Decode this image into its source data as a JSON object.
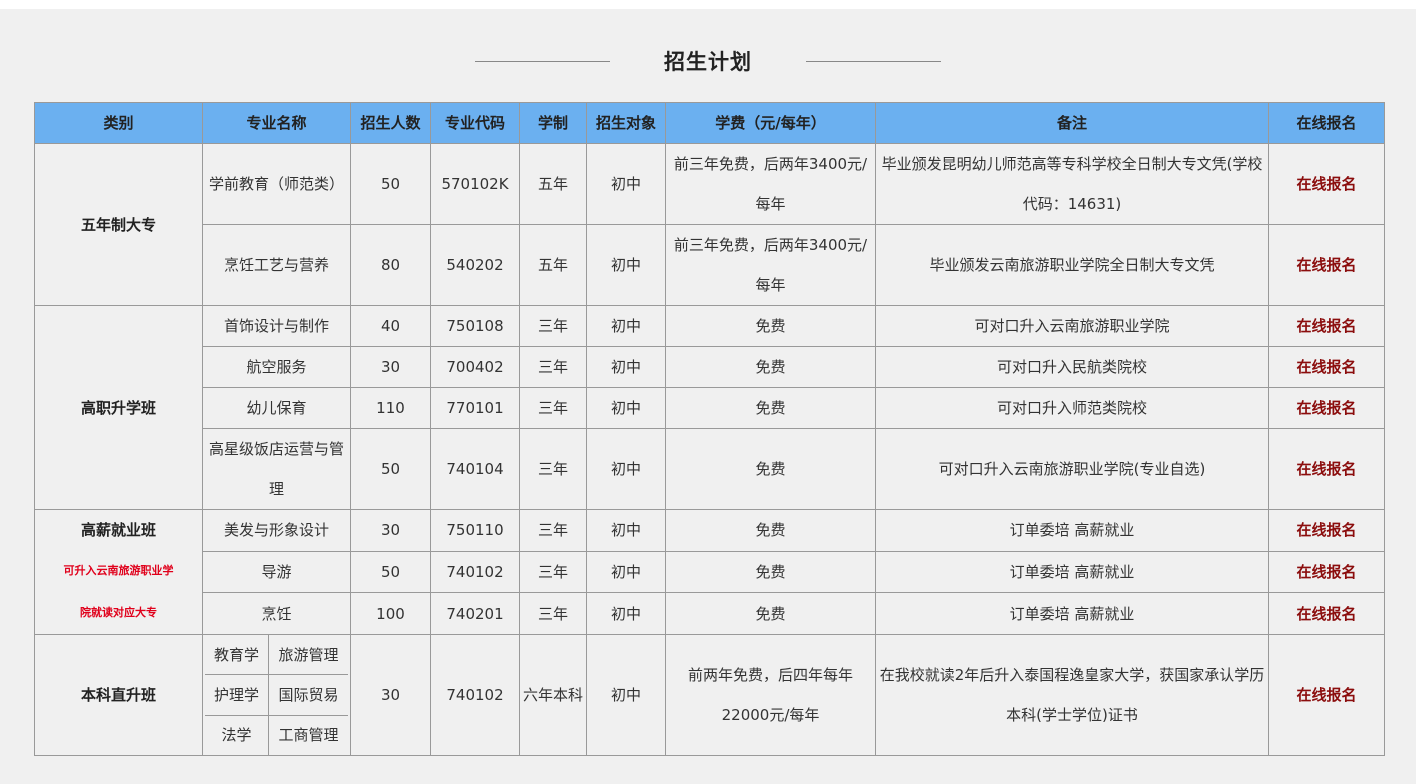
{
  "title": "招生计划",
  "headers": [
    "类别",
    "专业名称",
    "招生人数",
    "专业代码",
    "学制",
    "招生对象",
    "学费（元/每年）",
    "备注",
    "在线报名"
  ],
  "signup_label": "在线报名",
  "groups": {
    "g1": {
      "name": "五年制大专",
      "rows": [
        {
          "major": "学前教育（师范类）",
          "count": "50",
          "code": "570102K",
          "years": "五年",
          "target": "初中",
          "fee": "前三年免费，后两年3400元/每年",
          "note": "毕业颁发昆明幼儿师范高等专科学校全日制大专文凭(学校代码：14631)"
        },
        {
          "major": "烹饪工艺与营养",
          "count": "80",
          "code": "540202",
          "years": "五年",
          "target": "初中",
          "fee": "前三年免费，后两年3400元/每年",
          "note": "毕业颁发云南旅游职业学院全日制大专文凭"
        }
      ]
    },
    "g2": {
      "name": "高职升学班",
      "rows": [
        {
          "major": "首饰设计与制作",
          "count": "40",
          "code": "750108",
          "years": "三年",
          "target": "初中",
          "fee": "免费",
          "note": "可对口升入云南旅游职业学院"
        },
        {
          "major": "航空服务",
          "count": "30",
          "code": "700402",
          "years": "三年",
          "target": "初中",
          "fee": "免费",
          "note": "可对口升入民航类院校"
        },
        {
          "major": "幼儿保育",
          "count": "110",
          "code": "770101",
          "years": "三年",
          "target": "初中",
          "fee": "免费",
          "note": "可对口升入师范类院校"
        },
        {
          "major": "高星级饭店运营与管理",
          "count": "50",
          "code": "740104",
          "years": "三年",
          "target": "初中",
          "fee": "免费",
          "note": "可对口升入云南旅游职业学院(专业自选)"
        }
      ]
    },
    "g3": {
      "name": "高薪就业班",
      "sub_note": "可升入云南旅游职业学",
      "sub_note2": "院就读对应大专",
      "rows": [
        {
          "major": "美发与形象设计",
          "count": "30",
          "code": "750110",
          "years": "三年",
          "target": "初中",
          "fee": "免费",
          "note": "订单委培 高薪就业"
        },
        {
          "major": "导游",
          "count": "50",
          "code": "740102",
          "years": "三年",
          "target": "初中",
          "fee": "免费",
          "note": "订单委培 高薪就业"
        },
        {
          "major": "烹饪",
          "count": "100",
          "code": "740201",
          "years": "三年",
          "target": "初中",
          "fee": "免费",
          "note": "订单委培 高薪就业"
        }
      ]
    },
    "g4": {
      "name": "本科直升班",
      "majors": [
        [
          "教育学",
          "旅游管理"
        ],
        [
          "护理学",
          "国际贸易"
        ],
        [
          "法学",
          "工商管理"
        ]
      ],
      "count": "30",
      "code": "740102",
      "years": "六年本科",
      "target": "初中",
      "fee": "前两年免费，后四年每年22000元/每年",
      "note": "在我校就读2年后升入泰国程逸皇家大学，获国家承认学历本科(学士学位)证书"
    }
  }
}
